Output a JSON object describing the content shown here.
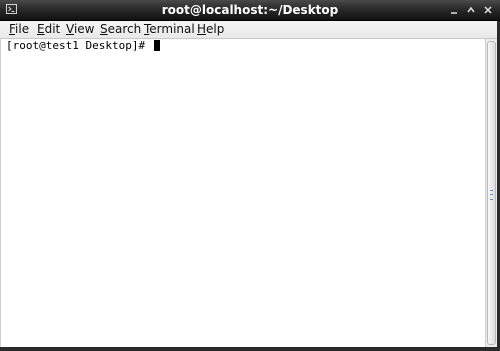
{
  "window": {
    "title": "root@localhost:~/Desktop"
  },
  "menubar": {
    "items": [
      {
        "label": "File",
        "mnemonic": "F",
        "rest": "ile"
      },
      {
        "label": "Edit",
        "mnemonic": "E",
        "rest": "dit"
      },
      {
        "label": "View",
        "mnemonic": "V",
        "rest": "iew"
      },
      {
        "label": "Search",
        "mnemonic": "S",
        "rest": "earch"
      },
      {
        "label": "Terminal",
        "mnemonic": "T",
        "rest": "erminal"
      },
      {
        "label": "Help",
        "mnemonic": "H",
        "rest": "elp"
      }
    ]
  },
  "terminal": {
    "prompt": "[root@test1 Desktop]# "
  },
  "icons": {
    "window_menu": "terminal-window-icon",
    "minimize": "minimize-icon",
    "maximize": "maximize-icon",
    "close": "close-icon"
  },
  "colors": {
    "titlebar": "#1c1c1c",
    "title_text": "#ffffff",
    "menubar": "#eeeeee",
    "terminal_bg": "#ffffff",
    "terminal_fg": "#000000"
  }
}
